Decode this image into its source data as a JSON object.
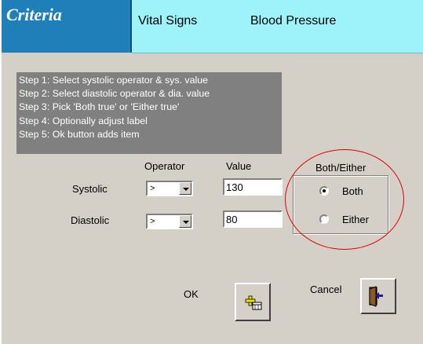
{
  "header": {
    "title": "Criteria",
    "category": "Vital Signs",
    "item": "Blood Pressure"
  },
  "steps": [
    "Step 1: Select systolic operator & sys. value",
    "Step 2: Select diastolic operator & dia. value",
    "Step 3: Pick 'Both true' or 'Either true'",
    "Step 4: Optionally adjust label",
    "Step 5: Ok button adds item"
  ],
  "columns": {
    "operator": "Operator",
    "value": "Value"
  },
  "systolic": {
    "label": "Systolic",
    "operator": ">",
    "value": "130"
  },
  "diastolic": {
    "label": "Diastolic",
    "operator": ">",
    "value": "80"
  },
  "both_either": {
    "title": "Both/Either",
    "options": [
      {
        "label": "Both",
        "selected": true
      },
      {
        "label": "Either",
        "selected": false
      }
    ]
  },
  "buttons": {
    "ok_label": "OK",
    "cancel_label": "Cancel"
  },
  "colors": {
    "header_left": "#1f7fb9",
    "header_right": "#9ef3fa",
    "steps_bg": "#808080",
    "highlight_circle": "#e00000",
    "window": "#d4d0c8"
  },
  "icons": {
    "ok": "add-item-icon",
    "cancel": "exit-door-icon"
  }
}
